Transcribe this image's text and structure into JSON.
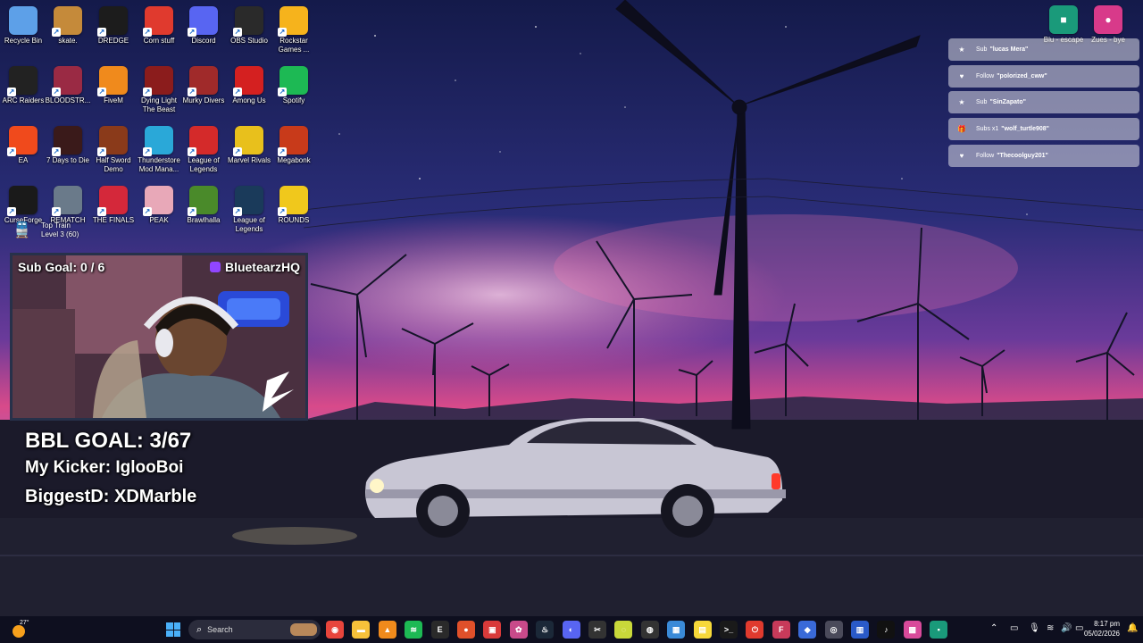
{
  "desktop": {
    "icons": [
      {
        "label": "Recycle Bin",
        "icon": "recycle-bin-icon",
        "color": "#5da0e8"
      },
      {
        "label": "skate.",
        "icon": "skate-icon",
        "color": "#c58a3a"
      },
      {
        "label": "DREDGE",
        "icon": "dredge-icon",
        "color": "#1c1c1c"
      },
      {
        "label": "Corn stuff",
        "icon": "power-icon",
        "color": "#e03a2e"
      },
      {
        "label": "Discord",
        "icon": "discord-icon",
        "color": "#5865f2"
      },
      {
        "label": "OBS Studio",
        "icon": "obs-icon",
        "color": "#2a2a2a"
      },
      {
        "label": "Rockstar Games ...",
        "icon": "rockstar-icon",
        "color": "#f6b31c"
      },
      {
        "label": "ARC Raiders",
        "icon": "arc-raiders-icon",
        "color": "#222222"
      },
      {
        "label": "BLOODSTR...",
        "icon": "bloodstrike-icon",
        "color": "#9a2a44"
      },
      {
        "label": "FiveM",
        "icon": "fivem-icon",
        "color": "#f08a1c"
      },
      {
        "label": "Dying Light The Beast",
        "icon": "dying-light-icon",
        "color": "#8b1c1c"
      },
      {
        "label": "Murky Divers",
        "icon": "murky-divers-icon",
        "color": "#a02a2a"
      },
      {
        "label": "Among Us",
        "icon": "among-us-icon",
        "color": "#d42020"
      },
      {
        "label": "Spotify",
        "icon": "spotify-icon",
        "color": "#1db954"
      },
      {
        "label": "EA",
        "icon": "ea-icon",
        "color": "#f04a1c"
      },
      {
        "label": "7 Days to Die",
        "icon": "seven-days-icon",
        "color": "#3a1a1a"
      },
      {
        "label": "Half Sword Demo",
        "icon": "half-sword-icon",
        "color": "#8a3a1a"
      },
      {
        "label": "Thunderstore Mod Mana...",
        "icon": "thunderstore-icon",
        "color": "#2aa8d8"
      },
      {
        "label": "League of Legends",
        "icon": "league-icon",
        "color": "#d42a2a"
      },
      {
        "label": "Marvel Rivals",
        "icon": "marvel-rivals-icon",
        "color": "#e8c01c"
      },
      {
        "label": "Megabonk",
        "icon": "megabonk-icon",
        "color": "#c83a1a"
      },
      {
        "label": "CurseForge",
        "icon": "curseforge-icon",
        "color": "#1a1a1a"
      },
      {
        "label": "REMATCH",
        "icon": "rematch-icon",
        "color": "#6a7a8a"
      },
      {
        "label": "THE FINALS",
        "icon": "the-finals-icon",
        "color": "#d4283a"
      },
      {
        "label": "PEAK",
        "icon": "peak-icon",
        "color": "#e8a8b8"
      },
      {
        "label": "Brawlhalla",
        "icon": "brawlhalla-icon",
        "color": "#4a8a2a"
      },
      {
        "label": "League of Legends",
        "icon": "league-of-legends-icon",
        "color": "#1a3a5a"
      },
      {
        "label": "ROUNDS",
        "icon": "rounds-icon",
        "color": "#f0c81c"
      }
    ],
    "top_train": {
      "line1": "Top Train",
      "line2": "Level 3  (60)"
    },
    "right_icons": [
      {
        "label": "Blu - escape",
        "icon": "blu-escape-icon",
        "color": "#1a9a7a"
      },
      {
        "label": "Zues - bye",
        "icon": "zues-bye-icon",
        "color": "#d83a8a"
      }
    ]
  },
  "alerts": [
    {
      "type": "Sub",
      "name": "\"lucas Mera\"",
      "icon": "star-icon",
      "glyph": "★"
    },
    {
      "type": "Follow",
      "name": "\"polorized_cww\"",
      "icon": "heart-icon",
      "glyph": "♥"
    },
    {
      "type": "Sub",
      "name": "\"SinZapato\"",
      "icon": "star-icon",
      "glyph": "★"
    },
    {
      "type": "Subs x1",
      "name": "\"wolf_turtle908\"",
      "icon": "gift-icon",
      "glyph": "🎁"
    },
    {
      "type": "Follow",
      "name": "\"Thecoolguy201\"",
      "icon": "heart-icon",
      "glyph": "♥"
    }
  ],
  "webcam": {
    "sub_goal": "Sub Goal:  0 / 6",
    "channel": "BluetearzHQ"
  },
  "stream_stats": {
    "bbl_goal": "BBL GOAL: 3/67",
    "kicker": "My Kicker: IglooBoi",
    "biggest": "BiggestD: XDMarble"
  },
  "taskbar": {
    "weather_temp": "27°",
    "search_placeholder": "Search",
    "time": "8:17 pm",
    "date": "05/02/2026",
    "apps": [
      {
        "icon": "chrome-icon",
        "color": "#e8453c"
      },
      {
        "icon": "file-explorer-icon",
        "color": "#f6c13a"
      },
      {
        "icon": "vlc-icon",
        "color": "#f08a1c"
      },
      {
        "icon": "spotify-icon",
        "color": "#1db954"
      },
      {
        "icon": "epic-games-icon",
        "color": "#2a2a2a"
      },
      {
        "icon": "app-icon",
        "color": "#e0502a"
      },
      {
        "icon": "app-icon",
        "color": "#d83a3a"
      },
      {
        "icon": "app-icon",
        "color": "#c84a8a"
      },
      {
        "icon": "steam-icon",
        "color": "#1b2838"
      },
      {
        "icon": "discord-icon",
        "color": "#5865f2"
      },
      {
        "icon": "capcut-icon",
        "color": "#333333"
      },
      {
        "icon": "app-icon",
        "color": "#c8d83a"
      },
      {
        "icon": "obs-icon",
        "color": "#333333"
      },
      {
        "icon": "photos-icon",
        "color": "#3a8ad8"
      },
      {
        "icon": "sticky-notes-icon",
        "color": "#f6d83a"
      },
      {
        "icon": "terminal-icon",
        "color": "#1a1a1a"
      },
      {
        "icon": "app-icon",
        "color": "#e03a2e"
      },
      {
        "icon": "app-icon",
        "color": "#c83a5a"
      },
      {
        "icon": "app-icon",
        "color": "#3a6ad8"
      },
      {
        "icon": "app-icon",
        "color": "#4a4a5a"
      },
      {
        "icon": "app-icon",
        "color": "#2a5ac8"
      },
      {
        "icon": "tiktok-icon",
        "color": "#111111"
      },
      {
        "icon": "app-icon",
        "color": "#d84a9a"
      },
      {
        "icon": "app-icon",
        "color": "#1a9a7a"
      }
    ],
    "app_glyphs": [
      "◉",
      "▬",
      "▲",
      "≋",
      "E",
      "●",
      "▣",
      "✿",
      "♨",
      "◐",
      "✂",
      "◌",
      "◍",
      "▦",
      "▤",
      ">_",
      "⏻",
      "F",
      "◆",
      "◎",
      "▥",
      "♪",
      "▩",
      "▪"
    ]
  }
}
